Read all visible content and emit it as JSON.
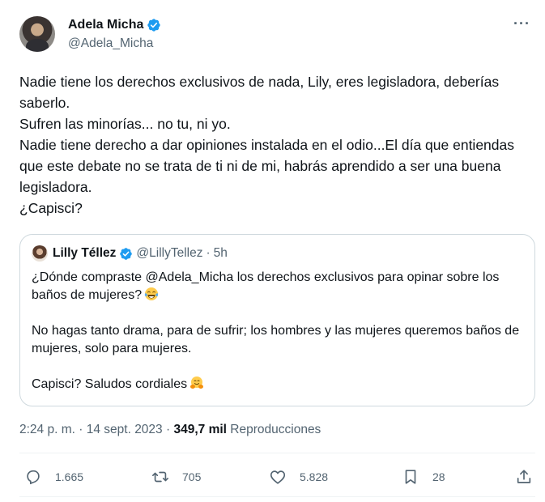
{
  "author": {
    "display_name": "Adela Micha",
    "handle": "@Adela_Micha",
    "verified": true,
    "more_label": "···"
  },
  "tweet": {
    "lines": [
      "Nadie tiene los derechos exclusivos de nada, Lily, eres legisladora, deberías saberlo.",
      "Sufren las minorías... no tu, ni yo.",
      "Nadie tiene derecho a dar opiniones instalada en el odio...El día que entiendas que este debate no se trata de ti ni de mi, habrás aprendido a ser una buena legisladora.",
      "¿Capisci?"
    ]
  },
  "quote": {
    "display_name": "Lilly Téllez",
    "handle": "@LillyTellez",
    "separator": "·",
    "time": "5h",
    "paragraph1": "¿Dónde compraste @Adela_Micha los derechos exclusivos para opinar sobre los baños de mujeres?",
    "paragraph2": "No hagas tanto drama, para de sufrir; los hombres y las mujeres queremos baños de mujeres, solo para mujeres.",
    "paragraph3": "Capisci? Saludos cordiales",
    "emoji1": "face-with-tears-of-joy",
    "emoji2": "hugging-face"
  },
  "meta": {
    "time": "2:24 p. m.",
    "sep1": "·",
    "date": "14 sept. 2023",
    "sep2": "·",
    "views_count": "349,7 mil",
    "views_label": "Reproducciones"
  },
  "actions": {
    "replies": "1.665",
    "reposts": "705",
    "likes": "5.828",
    "bookmarks": "28"
  },
  "colors": {
    "text": "#0f1419",
    "secondary": "#536471",
    "verified": "#1d9bf0",
    "border": "#cfd9de"
  }
}
